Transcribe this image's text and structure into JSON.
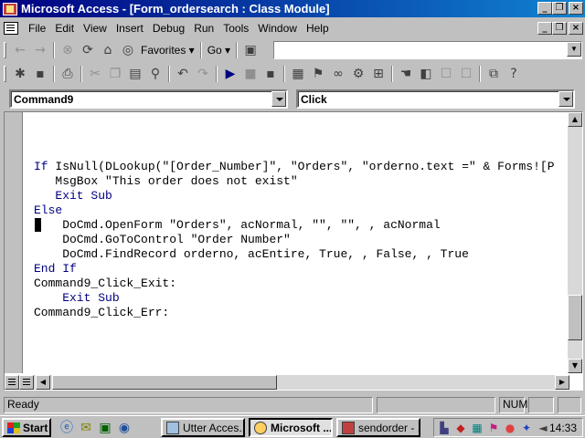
{
  "window": {
    "title": "Microsoft Access - [Form_ordersearch : Class Module]",
    "caption_min": "_",
    "caption_restore": "❐",
    "caption_close": "×"
  },
  "menu": {
    "items": [
      "File",
      "Edit",
      "View",
      "Insert",
      "Debug",
      "Run",
      "Tools",
      "Window",
      "Help"
    ]
  },
  "web_toolbar": {
    "favorites_label": "Favorites ▾",
    "go_label": "Go ▾",
    "address_value": ""
  },
  "combos": {
    "object": "Command9",
    "procedure": "Click"
  },
  "code": {
    "lines": [
      "If IsNull(DLookup(\"[Order_Number]\", \"Orders\", \"orderno.text =\" & Forms![P",
      "   MsgBox \"This order does not exist\"",
      "   Exit Sub",
      "Else",
      "",
      "    DoCmd.OpenForm \"Orders\", acNormal, \"\", \"\", , acNormal",
      "    DoCmd.GoToControl \"Order Number\"",
      "    DoCmd.FindRecord orderno, acEntire, True, , False, , True",
      "End If",
      "",
      "Command9_Click_Exit:",
      "    Exit Sub",
      "",
      "Command9_Click_Err:"
    ]
  },
  "status": {
    "text": "Ready",
    "num": "NUM"
  },
  "taskbar": {
    "start_label": "Start",
    "tasks": [
      {
        "label": "Utter Acces...",
        "active": false
      },
      {
        "label": "Microsoft ...",
        "active": true
      },
      {
        "label": "sendorder - ...",
        "active": false
      }
    ],
    "clock": "14:33"
  },
  "colors": {
    "title_start": "#000080",
    "title_end": "#1084d0",
    "keyword": "#000080",
    "face": "#c0c0c0"
  }
}
